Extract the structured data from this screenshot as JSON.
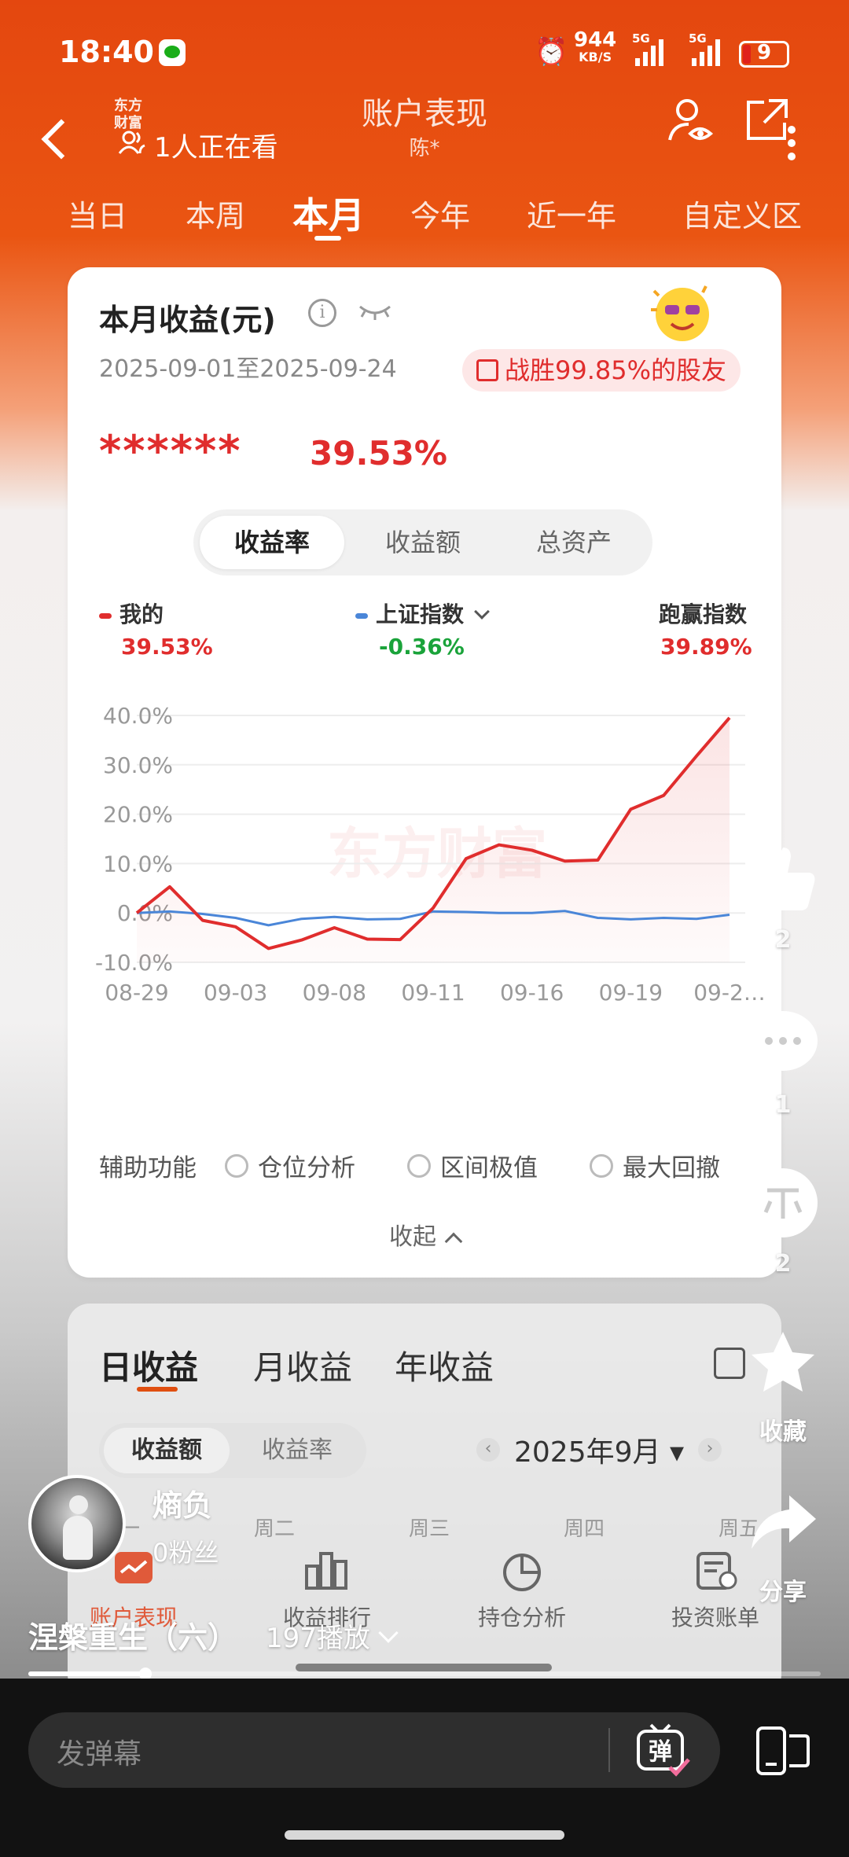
{
  "status_bar": {
    "time": "18:40",
    "net_speed": "944",
    "net_unit": "KB/S",
    "signal_label_1": "5G",
    "signal_label_2": "5G",
    "battery": "9"
  },
  "header": {
    "logo_text_1": "东方",
    "logo_text_2": "财富",
    "viewers": "1人正在看",
    "title": "账户表现",
    "subtitle": "陈*"
  },
  "period_tabs": [
    "当日",
    "本周",
    "本月",
    "今年",
    "近一年",
    "自定义区"
  ],
  "period_active_index": 2,
  "summary": {
    "title": "本月收益(元)",
    "date_range": "2025-09-01至2025-09-24",
    "beat_text": "战胜99.85%的股友",
    "hidden_amount": "******",
    "return_pct": "39.53%"
  },
  "metric_tabs": [
    "收益率",
    "收益额",
    "总资产"
  ],
  "metric_active_index": 0,
  "legend": [
    {
      "label": "我的",
      "value": "39.53%",
      "color": "#e02d2d"
    },
    {
      "label": "上证指数",
      "value": "-0.36%",
      "color": "#4a86d8"
    },
    {
      "label": "跑赢指数",
      "value": "39.89%",
      "color": "#e02d2d"
    }
  ],
  "chart_data": {
    "type": "line",
    "x": [
      "08-29",
      "09-01",
      "09-02",
      "09-03",
      "09-04",
      "09-05",
      "09-08",
      "09-09",
      "09-10",
      "09-11",
      "09-12",
      "09-15",
      "09-16",
      "09-17",
      "09-18",
      "09-19",
      "09-22",
      "09-23",
      "09-24"
    ],
    "x_tick_labels": [
      "08-29",
      "09-03",
      "09-08",
      "09-11",
      "09-16",
      "09-19",
      "09-2…"
    ],
    "x_tick_index": [
      0,
      3,
      6,
      9,
      12,
      15,
      18
    ],
    "y_tick_labels": [
      "40.0%",
      "30.0%",
      "20.0%",
      "10.0%",
      "0.0%",
      "-10.0%"
    ],
    "ylim": [
      -10,
      40
    ],
    "series": [
      {
        "name": "我的",
        "color": "#e02d2d",
        "values": [
          0,
          5.3,
          -1.5,
          -2.8,
          -7.2,
          -5.5,
          -3.0,
          -5.3,
          -5.4,
          1.0,
          11.0,
          13.8,
          12.7,
          10.5,
          10.7,
          21.0,
          23.8,
          31.8,
          39.53
        ]
      },
      {
        "name": "上证指数",
        "color": "#4a86d8",
        "values": [
          0,
          0.3,
          -0.2,
          -1.0,
          -2.5,
          -1.2,
          -0.8,
          -1.3,
          -1.2,
          0.3,
          0.2,
          0.0,
          0.0,
          0.4,
          -1.0,
          -1.3,
          -1.0,
          -1.2,
          -0.36
        ]
      }
    ]
  },
  "watermark": "东方财富",
  "aux": {
    "label": "辅助功能",
    "options": [
      "仓位分析",
      "区间极值",
      "最大回撤"
    ],
    "collapse": "收起"
  },
  "earnings": {
    "tabs": [
      "日收益",
      "月收益",
      "年收益"
    ],
    "active_tab_index": 0,
    "toggle": [
      "收益额",
      "收益率"
    ],
    "toggle_active_index": 0,
    "month": "2025年9月",
    "weekdays": [
      "周一",
      "周二",
      "周三",
      "周四",
      "周五"
    ]
  },
  "app_nav": [
    {
      "label": "账户表现",
      "icon": "trend-icon"
    },
    {
      "label": "收益排行",
      "icon": "bar-chart-icon"
    },
    {
      "label": "持仓分析",
      "icon": "pie-chart-icon"
    },
    {
      "label": "投资账单",
      "icon": "bill-icon"
    }
  ],
  "side_actions": {
    "like_count": "2",
    "comment_count": "1",
    "coin_count": "2",
    "favorite_label": "收藏",
    "share_label": "分享"
  },
  "author": {
    "name": "熵负",
    "fans": "0粉丝"
  },
  "video": {
    "title": "涅槃重生（六）",
    "plays": "197播放",
    "progress": 0.148
  },
  "danmaku": {
    "placeholder": "发弹幕",
    "button": "弹"
  }
}
